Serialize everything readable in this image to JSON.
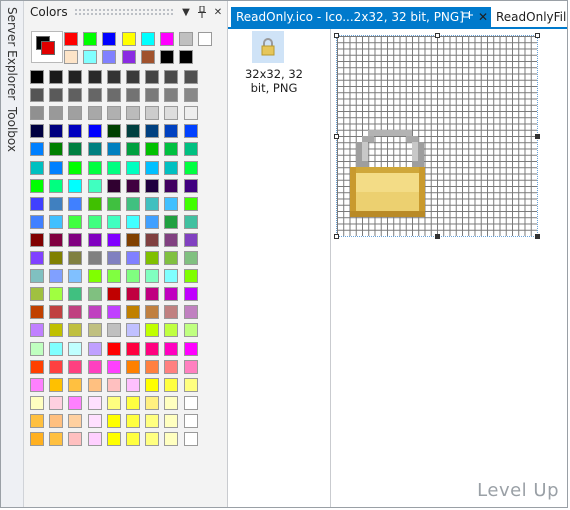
{
  "side_tabs": [
    "Server Explorer",
    "Toolbox"
  ],
  "colors_panel": {
    "title": "Colors",
    "pin_icon": "pin-icon",
    "close_icon": "close-icon",
    "menu_icon": "chevron-down-icon",
    "foreground": "#000000",
    "background": "#e00000",
    "row0": [
      "#ff0000",
      "#00ff00",
      "#0000ff",
      "#ffff00",
      "#00ffff",
      "#ff00ff",
      "#c0c0c0",
      "#ffffff"
    ],
    "row1": [
      "#fde4c8",
      "#80ffff",
      "#8080ff",
      "#8a2be2",
      "#a0522d",
      "#000000",
      "#000000"
    ],
    "rows": [
      [
        "#000000",
        "#1a1a1a",
        "#222222",
        "#2a2a2a",
        "#333333",
        "#3a3a3a",
        "#444444",
        "#4a4a4a",
        "#505050"
      ],
      [
        "#555555",
        "#5a5a5a",
        "#606060",
        "#666666",
        "#6c6c6c",
        "#737373",
        "#7a7a7a",
        "#808080",
        "#888888"
      ],
      [
        "#909090",
        "#999999",
        "#a0a0a0",
        "#a8a8a8",
        "#b0b0b0",
        "#bbbbbb",
        "#cccccc",
        "#dddddd",
        "#eeeeee"
      ],
      [
        "#000040",
        "#000080",
        "#0000c0",
        "#0000ff",
        "#004000",
        "#004040",
        "#004080",
        "#0040c0",
        "#0040ff"
      ],
      [
        "#0080ff",
        "#008000",
        "#008040",
        "#008080",
        "#0080c0",
        "#00a040",
        "#00c000",
        "#00c040",
        "#00c080"
      ],
      [
        "#00c0c0",
        "#0080ff",
        "#00ff00",
        "#00ff40",
        "#00ff80",
        "#00ffc0",
        "#00c0ff",
        "#00c0c0",
        "#00ff40"
      ],
      [
        "#00ff00",
        "#00ff80",
        "#00ffff",
        "#40ffc0",
        "#300030",
        "#400040",
        "#200040",
        "#400060",
        "#400080"
      ],
      [
        "#4040ff",
        "#4080c0",
        "#4080ff",
        "#40c000",
        "#40c040",
        "#40c080",
        "#40c0c0",
        "#40c0ff",
        "#40ff00"
      ],
      [
        "#4080ff",
        "#40c0ff",
        "#40ff40",
        "#40ff80",
        "#40ffc0",
        "#40ffff",
        "#40a0ff",
        "#20a040",
        "#40c0a0"
      ],
      [
        "#800000",
        "#800040",
        "#800080",
        "#8000c0",
        "#8000ff",
        "#804000",
        "#804040",
        "#804080",
        "#8040c0"
      ],
      [
        "#8040ff",
        "#808000",
        "#808040",
        "#808080",
        "#8080c0",
        "#8080ff",
        "#80c000",
        "#80c040",
        "#80c080"
      ],
      [
        "#80c0c0",
        "#80a0ff",
        "#80c0ff",
        "#80ff00",
        "#80ff40",
        "#80ff80",
        "#80ffc0",
        "#80ffff",
        "#80ff00"
      ],
      [
        "#a0c040",
        "#a0ff40",
        "#40c080",
        "#80c080",
        "#c00000",
        "#c00040",
        "#c00080",
        "#c000c0",
        "#c000ff"
      ],
      [
        "#c04000",
        "#c04040",
        "#c04080",
        "#c040c0",
        "#c040ff",
        "#c08000",
        "#c08040",
        "#c08080",
        "#c080c0"
      ],
      [
        "#c080ff",
        "#c0c000",
        "#c0c040",
        "#c0c080",
        "#c0c0c0",
        "#c0c0ff",
        "#c0ff00",
        "#c0ff40",
        "#c0ff80"
      ],
      [
        "#c0ffc0",
        "#80ffff",
        "#c0ffff",
        "#c0a0ff",
        "#ff0000",
        "#ff0040",
        "#ff0080",
        "#ff00c0",
        "#ff00ff"
      ],
      [
        "#ff4000",
        "#ff4040",
        "#ff4080",
        "#ff40c0",
        "#ff40ff",
        "#ff8000",
        "#ff8040",
        "#ff8080",
        "#ff80c0"
      ],
      [
        "#ff80ff",
        "#ffc000",
        "#ffc040",
        "#ffc080",
        "#ffc0c0",
        "#ffc0ff",
        "#ffff00",
        "#ffff40",
        "#ffff80"
      ],
      [
        "#ffffc0",
        "#ffd0e0",
        "#ff80ff",
        "#ffe0ff",
        "#ffff80",
        "#ffff40",
        "#fff080",
        "#ffffc0",
        "#ffffff"
      ],
      [
        "#ffc040",
        "#ffc080",
        "#ffd0a0",
        "#ffe0ff",
        "#ffff00",
        "#ffff40",
        "#ffff80",
        "#ffffc0",
        "#ffffff"
      ],
      [
        "#ffb020",
        "#ffc040",
        "#ffc0c0",
        "#ffd0ff",
        "#ffff00",
        "#ffff40",
        "#ffff80",
        "#ffffc0",
        "#ffffff"
      ]
    ]
  },
  "document": {
    "active_tab": "ReadOnly.ico - Ico...2x32, 32 bit, PNG]",
    "inactive_tab": "ReadOnlyFile",
    "pin_icon": "pin-icon",
    "close_icon": "close-icon",
    "formats": [
      {
        "icon": "lock-icon",
        "label": "32x32, 32 bit, PNG"
      }
    ],
    "canvas_icon": "padlock-icon"
  },
  "watermark": "Level Up"
}
